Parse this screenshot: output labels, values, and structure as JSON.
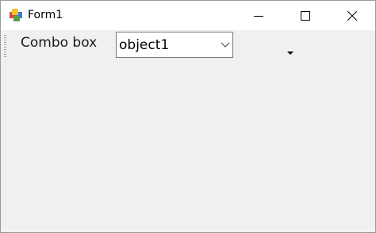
{
  "window": {
    "title": "Form1",
    "icon": "winforms-app-icon",
    "controls": {
      "minimize_icon": "minimize-icon",
      "maximize_icon": "maximize-icon",
      "close_icon": "close-icon"
    }
  },
  "form": {
    "combo_label": "Combo box",
    "combo_value": "object1",
    "combo_icon": "chevron-down-icon",
    "extra_dropdown_icon": "dropdown-arrow-icon"
  },
  "colors": {
    "titlebar": "#ffffff",
    "client": "#f0f0f0",
    "combo_border": "#7a7a7a"
  }
}
